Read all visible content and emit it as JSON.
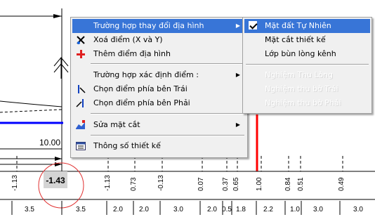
{
  "drawing": {
    "elevation_label": "10.00",
    "highlight_value": "-1.43",
    "row1_values": [
      "-1.13",
      "-1.13",
      "0.73",
      "-0.13",
      "0.07",
      "0.37",
      "0.65",
      "1.00",
      "0.84",
      "0.51",
      "0.49"
    ],
    "row2_values": [
      "3.5",
      "3.5",
      "2.0",
      "2.0",
      "3.0",
      "2.0",
      "0.5",
      "1.8",
      "2.2",
      "1.0",
      "3.0",
      "3.0"
    ]
  },
  "context_menu": {
    "items": [
      {
        "label": "Trường hợp thay đổi địa hình",
        "icon": "",
        "submenu": true,
        "selected": true
      },
      {
        "label": "Xoá điểm  (X và Y)",
        "icon": "delete-point-icon"
      },
      {
        "label": "Thêm điểm  địa hình",
        "icon": "add-point-icon"
      },
      {
        "label": "Trường hợp xác định điểm  :",
        "icon": "",
        "submenu": true
      },
      {
        "label": "Chọn điểm phía  bên Trái",
        "icon": "pick-left-icon"
      },
      {
        "label": "Chọn điểm phía bên Phải",
        "icon": "pick-right-icon"
      },
      {
        "label": "Sửa mặt cắt",
        "icon": "edit-section-icon",
        "submenu": true
      },
      {
        "label": "Thông số thiết kế",
        "icon": "design-params-icon"
      }
    ]
  },
  "submenu": {
    "items": [
      {
        "label": "Mặt đất Tự Nhiên",
        "checked": true,
        "selected": true
      },
      {
        "label": "Mặt cắt thiết kế"
      },
      {
        "label": "Lớp bùn lòng kênh"
      },
      {
        "label": "Nghiệm Thu Lòng",
        "disabled": true
      },
      {
        "label": "Nghiệm thu bờ Trái",
        "disabled": true
      },
      {
        "label": "Nghiệm thu bờ Phải",
        "disabled": true
      }
    ]
  },
  "colors": {
    "menu_highlight": "#3875d7",
    "red_line": "#ff0000",
    "blue_line": "#0000ff",
    "highlight_cell": "#d4d4d4"
  }
}
